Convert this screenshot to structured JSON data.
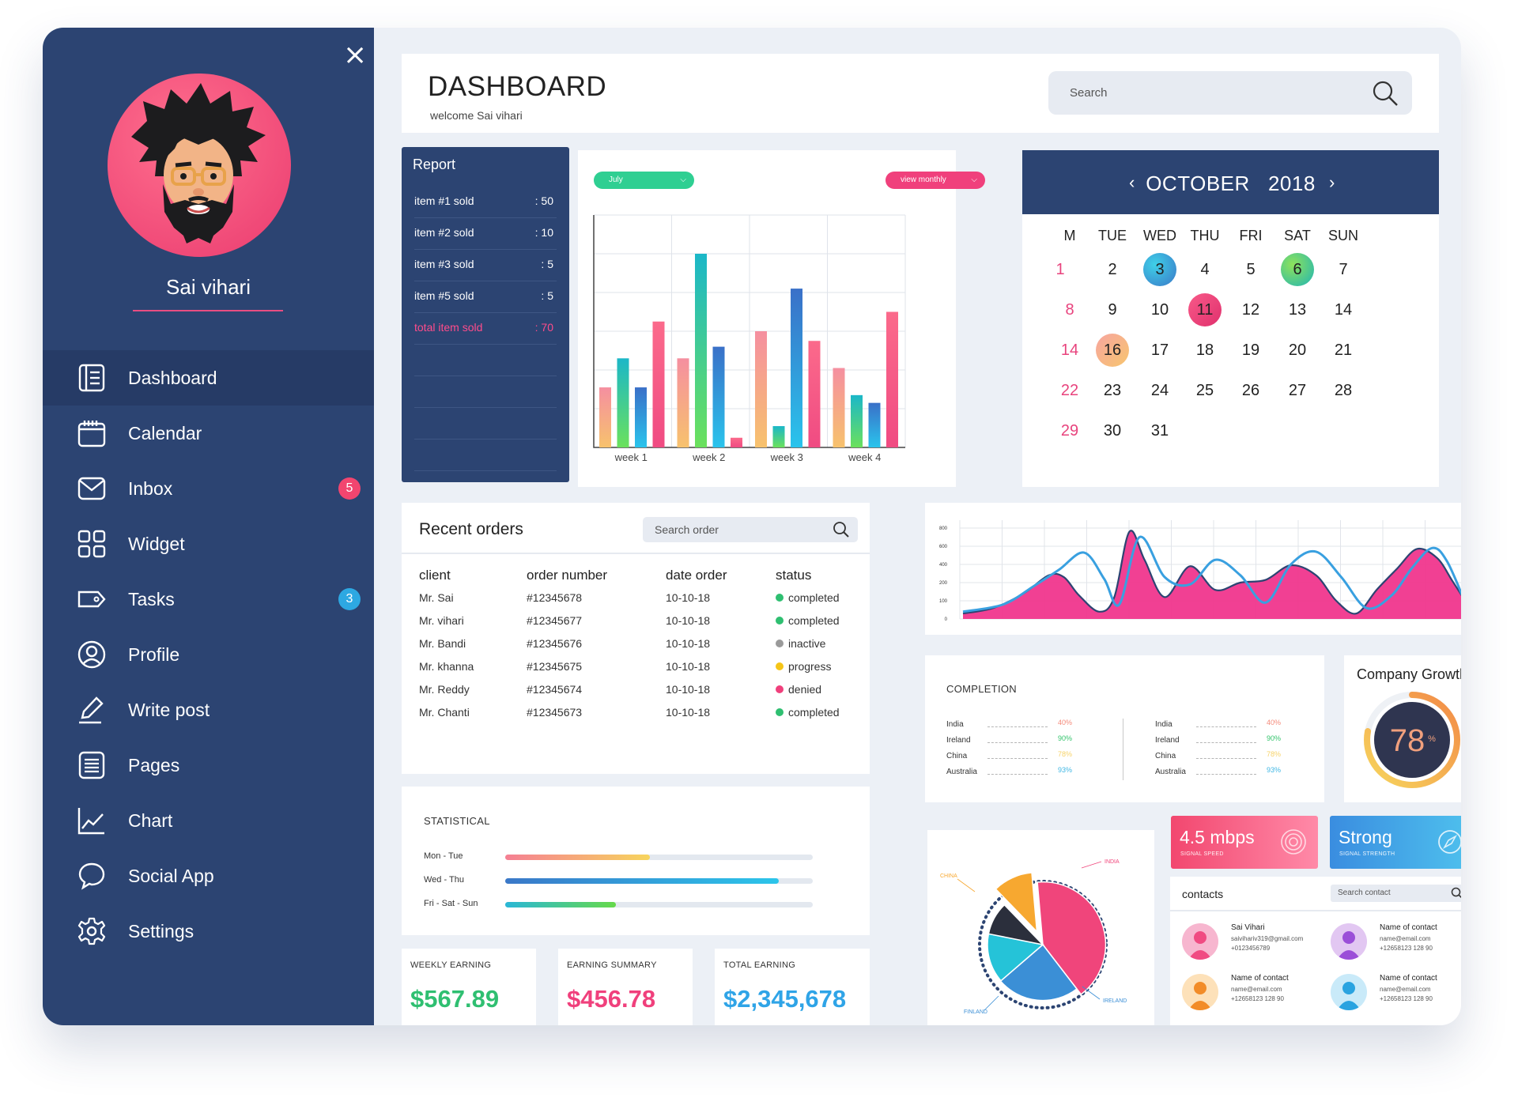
{
  "sidebar": {
    "username": "Sai vihari",
    "close_icon": "close-icon",
    "items": [
      {
        "label": "Dashboard",
        "icon": "dashboard-icon",
        "active": true
      },
      {
        "label": "Calendar",
        "icon": "calendar-icon"
      },
      {
        "label": "Inbox",
        "icon": "mail-icon",
        "badge": "5",
        "badge_color": "#f2456f"
      },
      {
        "label": "Widget",
        "icon": "widget-grid-icon"
      },
      {
        "label": "Tasks",
        "icon": "tag-icon",
        "badge": "3",
        "badge_color": "#2da8e2"
      },
      {
        "label": "Profile",
        "icon": "user-icon"
      },
      {
        "label": "Write post",
        "icon": "pencil-icon"
      },
      {
        "label": "Pages",
        "icon": "pages-icon"
      },
      {
        "label": "Chart",
        "icon": "line-chart-icon"
      },
      {
        "label": "Social App",
        "icon": "chat-bubble-icon"
      },
      {
        "label": "Settings",
        "icon": "gear-icon"
      }
    ]
  },
  "header": {
    "title": "DASHBOARD",
    "subtitle": "welcome Sai vihari",
    "search_placeholder": "Search"
  },
  "report": {
    "title": "Report",
    "rows": [
      {
        "label": "item #1 sold",
        "value": ": 50"
      },
      {
        "label": "item #2 sold",
        "value": ": 10"
      },
      {
        "label": "item #3 sold",
        "value": ": 5"
      },
      {
        "label": "item #5 sold",
        "value": ": 5"
      },
      {
        "label": "total item sold",
        "value": ": 70"
      }
    ]
  },
  "bar_panel": {
    "month_select": "July",
    "view_select": "view monthly"
  },
  "calendar": {
    "month": "OCTOBER",
    "year": "2018",
    "weekdays": [
      "M",
      "TUE",
      "WED",
      "THU",
      "FRI",
      "SAT",
      "SUN"
    ],
    "weeks": [
      [
        "1",
        "2",
        "3",
        "4",
        "5",
        "6",
        "7"
      ],
      [
        "8",
        "9",
        "10",
        "11",
        "12",
        "13",
        "14"
      ],
      [
        "14",
        "16",
        "17",
        "18",
        "19",
        "20",
        "21"
      ],
      [
        "22",
        "23",
        "24",
        "25",
        "26",
        "27",
        "28"
      ],
      [
        "29",
        "30",
        "31",
        "",
        "",
        "",
        ""
      ]
    ]
  },
  "orders": {
    "title": "Recent orders",
    "search_placeholder": "Search order",
    "columns": [
      "client",
      "order number",
      "date order",
      "status"
    ],
    "rows": [
      {
        "client": "Mr. Sai",
        "number": "#12345678",
        "date": "10-10-18",
        "status": "completed",
        "status_color": "#2fbf71"
      },
      {
        "client": "Mr. vihari",
        "number": "#12345677",
        "date": "10-10-18",
        "status": "completed",
        "status_color": "#2fbf71"
      },
      {
        "client": "Mr. Bandi",
        "number": "#12345676",
        "date": "10-10-18",
        "status": "inactive",
        "status_color": "#9a9a9a"
      },
      {
        "client": "Mr. khanna",
        "number": "#12345675",
        "date": "10-10-18",
        "status": "progress",
        "status_color": "#f5c518"
      },
      {
        "client": "Mr. Reddy",
        "number": "#12345674",
        "date": "10-10-18",
        "status": "denied",
        "status_color": "#f0407c"
      },
      {
        "client": "Mr. Chanti",
        "number": "#12345673",
        "date": "10-10-18",
        "status": "completed",
        "status_color": "#2fbf71"
      }
    ]
  },
  "completion": {
    "title": "COMPLETION",
    "left": [
      {
        "country": "India",
        "pct": "40%",
        "color": "#f58a7a"
      },
      {
        "country": "Ireland",
        "pct": "90%",
        "color": "#33c46c"
      },
      {
        "country": "China",
        "pct": "78%",
        "color": "#f7d36a"
      },
      {
        "country": "Australia",
        "pct": "93%",
        "color": "#3fb7e4"
      }
    ],
    "right": [
      {
        "country": "India",
        "pct": "40%",
        "color": "#f58a7a"
      },
      {
        "country": "Ireland",
        "pct": "90%",
        "color": "#33c46c"
      },
      {
        "country": "China",
        "pct": "78%",
        "color": "#f7d36a"
      },
      {
        "country": "Australia",
        "pct": "93%",
        "color": "#3fb7e4"
      }
    ]
  },
  "growth": {
    "title": "Company Growth",
    "value": "78",
    "unit": "%",
    "fraction": 0.78
  },
  "statistical": {
    "title": "STATISTICAL",
    "rows": [
      {
        "label": "Mon - Tue",
        "fraction": 0.47,
        "gradient": "linear-gradient(90deg,#f57f93,#f7d55d)"
      },
      {
        "label": "Wed - Thu",
        "fraction": 0.89,
        "gradient": "linear-gradient(90deg,#3a78c8,#2cc5ea)"
      },
      {
        "label": "Fri - Sat - Sun",
        "fraction": 0.36,
        "gradient": "linear-gradient(90deg,#2ab7d7,#66d94a)"
      }
    ]
  },
  "earnings": [
    {
      "label": "WEEKLY EARNING",
      "value": "$567.89",
      "color": "#2fbf71"
    },
    {
      "label": "EARNING SUMMARY",
      "value": "$456.78",
      "color": "#f0407c"
    },
    {
      "label": "TOTAL EARNING",
      "value": "$2,345,678",
      "color": "#2fa4e7"
    }
  ],
  "pie": {
    "labels": [
      "INDIA",
      "CHINA",
      "FINLAND",
      "IRELAND"
    ]
  },
  "speed_tiles": [
    {
      "value": "4.5 mbps",
      "label": "SIGNAL SPEED",
      "icon": "fingerprint-icon",
      "gradient": "linear-gradient(90deg,#f2476f,#ff8aa8)"
    },
    {
      "value": "Strong",
      "label": "SIGNAL STRENGTH",
      "icon": "compass-icon",
      "gradient": "linear-gradient(90deg,#3a8de0,#4fc2ee)"
    }
  ],
  "contacts": {
    "title": "contacts",
    "search_placeholder": "Search contact",
    "items": [
      {
        "name": "Sai Vihari",
        "email": "saivihariv319@gmail.com",
        "phone": "+0123456789",
        "avatar_color": "#f7b6cf",
        "figure_color": "#f04b82"
      },
      {
        "name": "Name of contact",
        "email": "name@email.com",
        "phone": "+12658123 128 90",
        "avatar_color": "#e2c7f2",
        "figure_color": "#9b4fd8"
      },
      {
        "name": "Name of contact",
        "email": "name@email.com",
        "phone": "+12658123 128 90",
        "avatar_color": "#fde1b9",
        "figure_color": "#f28c28"
      },
      {
        "name": "Name of contact",
        "email": "name@email.com",
        "phone": "+12658123 128 90",
        "avatar_color": "#c9eaf9",
        "figure_color": "#2aa3e0"
      }
    ]
  },
  "chart_data": [
    {
      "type": "bar",
      "categories": [
        "week 1",
        "week 2",
        "week 3",
        "week 4"
      ],
      "ylim": [
        0,
        6
      ],
      "grid": true,
      "series": [
        {
          "values": [
            1.55,
            2.3,
            3.0,
            2.05
          ],
          "gradient": [
            "#f7c26d",
            "#f58fa0"
          ]
        },
        {
          "values": [
            2.3,
            5.0,
            0.55,
            1.35
          ],
          "gradient": [
            "#6be15c",
            "#1bb7c8"
          ]
        },
        {
          "values": [
            1.55,
            2.6,
            4.1,
            1.15
          ],
          "gradient": [
            "#2ac4ec",
            "#3a70c8"
          ]
        },
        {
          "values": [
            3.25,
            0.25,
            2.75,
            3.5
          ],
          "gradient": [
            "#f04b82",
            "#fb6a8b"
          ]
        }
      ]
    },
    {
      "type": "area",
      "yticks": [
        0,
        100,
        200,
        400,
        600,
        800
      ],
      "ylim": [
        0,
        800
      ],
      "grid": true,
      "series": [
        {
          "type": "area",
          "color": "#f0368d",
          "x": [
            0,
            6,
            12,
            17,
            20,
            23,
            27,
            30,
            33,
            36,
            40,
            45,
            50,
            55,
            60,
            65,
            70,
            74,
            78,
            82,
            86,
            90,
            94,
            97,
            100
          ],
          "values": [
            30,
            60,
            140,
            280,
            260,
            130,
            40,
            120,
            760,
            450,
            120,
            380,
            160,
            200,
            230,
            390,
            280,
            100,
            30,
            160,
            350,
            570,
            470,
            220,
            80
          ]
        },
        {
          "type": "line",
          "color": "#39a0e0",
          "x": [
            0,
            8,
            14,
            19,
            24,
            28,
            31,
            35,
            40,
            45,
            50,
            55,
            60,
            65,
            70,
            75,
            80,
            85,
            89,
            93,
            96,
            100
          ],
          "values": [
            40,
            80,
            180,
            340,
            530,
            240,
            80,
            700,
            260,
            190,
            450,
            280,
            90,
            400,
            540,
            260,
            60,
            130,
            360,
            580,
            430,
            60
          ]
        }
      ]
    },
    {
      "type": "pie",
      "slices": [
        {
          "label": "INDIA",
          "value": 34,
          "color": "#f0457b"
        },
        {
          "label": "IRELAND",
          "value": 20,
          "color": "#3b8fd6"
        },
        {
          "label": "FINLAND",
          "value": 12,
          "color": "#25c3d8"
        },
        {
          "label": "",
          "value": 8,
          "color": "#2b2f3c"
        },
        {
          "label": "CHINA",
          "value": 9,
          "color": "#f7a830"
        }
      ]
    }
  ]
}
